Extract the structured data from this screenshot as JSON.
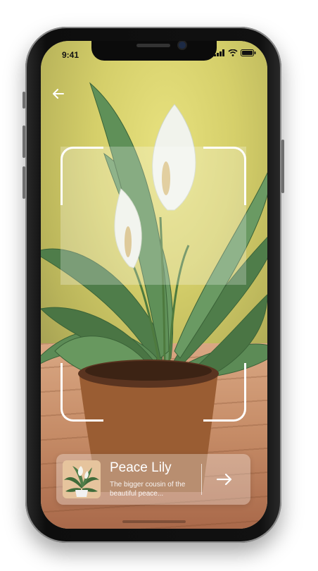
{
  "status_bar": {
    "time": "9:41"
  },
  "plant": {
    "name": "Peace Lily",
    "description": "The bigger cousin of the beautiful peace..."
  },
  "icons": {
    "back": "arrow-left-icon",
    "next": "arrow-right-icon",
    "signal": "cellular-signal-icon",
    "wifi": "wifi-icon",
    "battery": "battery-icon"
  },
  "colors": {
    "frame": "#ffffff",
    "card_text": "#ffffff"
  }
}
